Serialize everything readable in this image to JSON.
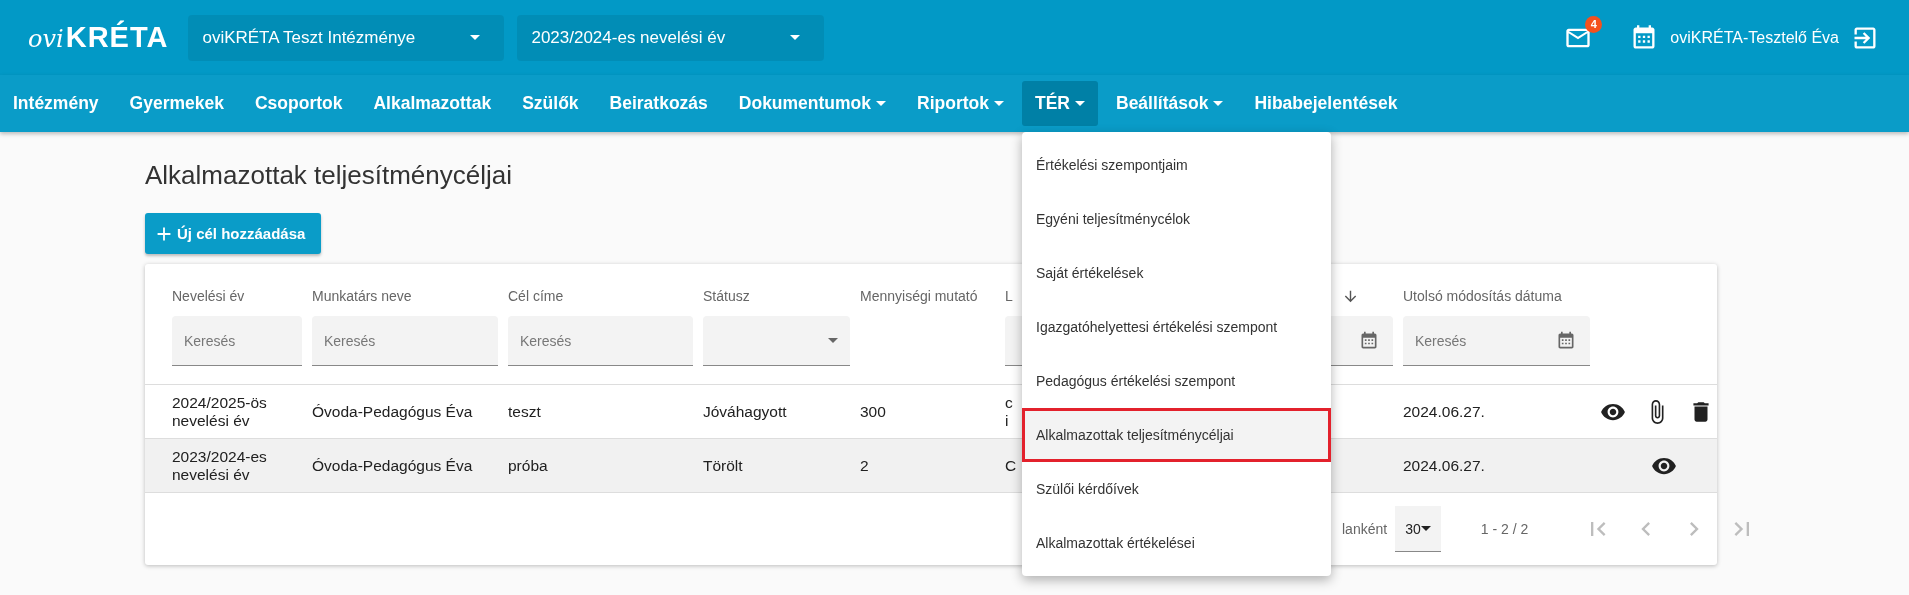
{
  "header": {
    "logo": {
      "prefix": "ovi",
      "name": "KRÉTA"
    },
    "institution_select": "oviKRÉTA Teszt Intézménye",
    "year_select": "2023/2024-es nevelési év",
    "messages_badge": "4",
    "user_name": "oviKRÉTA-Tesztelő Éva"
  },
  "nav": [
    {
      "label": "Intézmény",
      "dropdown": false,
      "selected": false
    },
    {
      "label": "Gyermekek",
      "dropdown": false,
      "selected": false
    },
    {
      "label": "Csoportok",
      "dropdown": false,
      "selected": false
    },
    {
      "label": "Alkalmazottak",
      "dropdown": false,
      "selected": false
    },
    {
      "label": "Szülők",
      "dropdown": false,
      "selected": false
    },
    {
      "label": "Beiratkozás",
      "dropdown": false,
      "selected": false
    },
    {
      "label": "Dokumentumok",
      "dropdown": true,
      "selected": false
    },
    {
      "label": "Riportok",
      "dropdown": true,
      "selected": false
    },
    {
      "label": "TÉR",
      "dropdown": true,
      "selected": true
    },
    {
      "label": "Beállítások",
      "dropdown": true,
      "selected": false
    },
    {
      "label": "Hibabejelentések",
      "dropdown": false,
      "selected": false
    }
  ],
  "menu": {
    "items": [
      {
        "label": "Értékelési szempontjaim",
        "selected": false
      },
      {
        "label": "Egyéni teljesítménycélok",
        "selected": false
      },
      {
        "label": "Saját értékelések",
        "selected": false
      },
      {
        "label": "Igazgatóhelyettesi értékelési szempont",
        "selected": false
      },
      {
        "label": "Pedagógus értékelési szempont",
        "selected": false
      },
      {
        "label": "Alkalmazottak teljesítménycéljai",
        "selected": true
      },
      {
        "label": "Szülői kérdőívek",
        "selected": false
      },
      {
        "label": "Alkalmazottak értékelései",
        "selected": false
      }
    ]
  },
  "page": {
    "title": "Alkalmazottak teljesítménycéljai",
    "add_button": "Új cél hozzáadása"
  },
  "table": {
    "columns": [
      {
        "label": "Nevelési év",
        "filter": {
          "kind": "text",
          "placeholder": "Keresés"
        }
      },
      {
        "label": "Munkatárs neve",
        "filter": {
          "kind": "text",
          "placeholder": "Keresés"
        }
      },
      {
        "label": "Cél címe",
        "filter": {
          "kind": "text",
          "placeholder": "Keresés"
        }
      },
      {
        "label": "Státusz",
        "filter": {
          "kind": "select"
        }
      },
      {
        "label": "Mennyiségi mutató"
      },
      {
        "label": "L",
        "filter": {
          "kind": "text"
        }
      },
      {
        "sorted": true,
        "filter": {
          "kind": "date"
        }
      },
      {
        "label": "Utolsó módosítás dátuma",
        "filter": {
          "kind": "date",
          "placeholder": "Keresés"
        }
      }
    ],
    "rows": [
      {
        "highlighted": false,
        "cells": [
          "2024/2025-ös nevelési év",
          "Óvoda-Pedagógus Éva",
          "teszt",
          "Jóváhagyott",
          "300",
          "c\ni",
          "",
          "2024.06.27."
        ],
        "actions": [
          {
            "kind": "view"
          },
          {
            "kind": "attach"
          },
          {
            "kind": "delete"
          }
        ]
      },
      {
        "highlighted": true,
        "cells": [
          "2023/2024-es nevelési év",
          "Óvoda-Pedagógus Éva",
          "próba",
          "Törölt",
          "2",
          "C",
          "",
          "2024.06.27."
        ],
        "actions": [
          {
            "kind": "view"
          }
        ]
      }
    ],
    "pagination": {
      "per_page_label": "lanként",
      "per_page": "30",
      "range": "1 - 2 / 2",
      "buttons": [
        {
          "kind": "first",
          "disabled": true
        },
        {
          "kind": "prev",
          "disabled": true
        },
        {
          "kind": "next",
          "disabled": true
        },
        {
          "kind": "last",
          "disabled": true
        }
      ]
    }
  }
}
